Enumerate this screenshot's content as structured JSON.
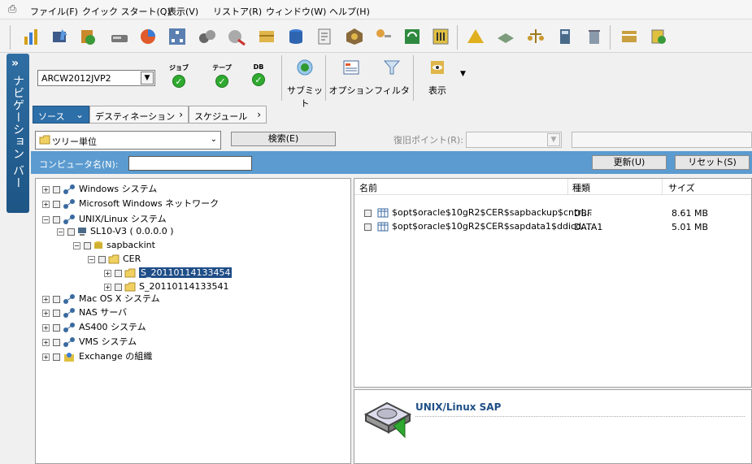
{
  "menu": [
    "ファイル(F)",
    "クイック スタート(Q)",
    "表示(V)",
    "リストア(R)",
    "ウィンドウ(W)",
    "ヘルプ(H)"
  ],
  "nav": {
    "label": "ナビゲーション バー",
    "chevron": "»"
  },
  "server": {
    "value": "ARCW2012JVP2"
  },
  "status": [
    {
      "label": "ジョブ"
    },
    {
      "label": "テープ"
    },
    {
      "label": "DB"
    }
  ],
  "actions": {
    "submit": "サブミット",
    "options": "オプション",
    "filter": "フィルタ",
    "view": "表示"
  },
  "tabs": {
    "source": "ソース",
    "destination": "デスティネーション",
    "schedule": "スケジュール"
  },
  "search": {
    "mode": "ツリー単位",
    "button": "検索(E)",
    "restore_point_label": "復旧ポイント(R):"
  },
  "computer": {
    "label": "コンピュータ名(N):",
    "refresh": "更新(U)",
    "reset": "リセット(S)"
  },
  "tree": {
    "windows": "Windows システム",
    "mswin": "Microsoft Windows ネットワーク",
    "unix": "UNIX/Linux システム",
    "sl10": "SL10-V3 ( 0.0.0.0 )",
    "sapbackint": "sapbackint",
    "cer": "CER",
    "s1": "S_20110114133454",
    "s2": "S_20110114133541",
    "mac": "Mac OS X システム",
    "nas": "NAS サーバ",
    "as400": "AS400 システム",
    "vms": "VMS システム",
    "exchange": "Exchange の組織"
  },
  "columns": {
    "name": "名前",
    "type": "種類",
    "size": "サイズ"
  },
  "files": [
    {
      "name": "$opt$oracle$10gR2$CER$sapbackup$cntrl...",
      "type": "DBF",
      "size": "8.61 MB"
    },
    {
      "name": "$opt$oracle$10gR2$CER$sapdata1$ddicd...",
      "type": "DATA1",
      "size": "5.01 MB"
    }
  ],
  "detail": {
    "title": "UNIX/Linux SAP"
  },
  "colors": {
    "accent": "#2d6fa8",
    "bluebar": "#5b9bd0",
    "selected": "#1f4d87",
    "ok": "#2faa2f"
  }
}
